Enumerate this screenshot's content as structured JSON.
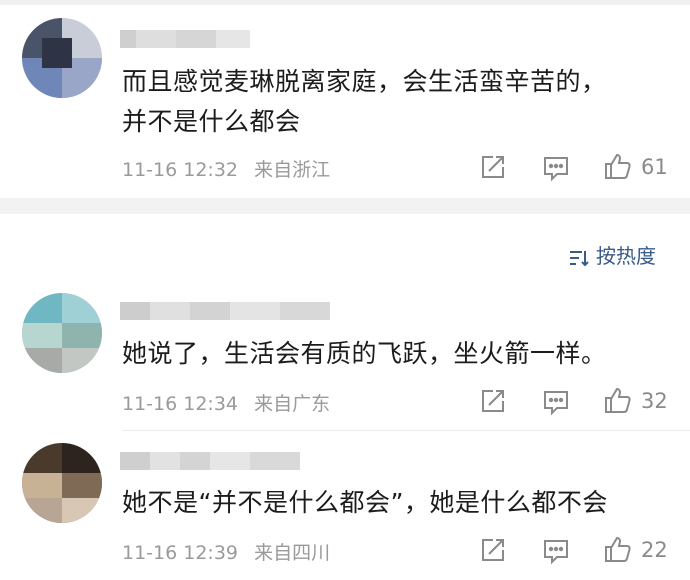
{
  "comments": [
    {
      "text_lines": [
        "而且感觉麦琳脱离家庭，会生活蛮辛苦的，",
        "并不是什么都会"
      ],
      "time": "11-16 12:32",
      "location": "来自浙江",
      "likes": "61"
    },
    {
      "text_lines": [
        "她说了，生活会有质的飞跃，坐火箭一样。"
      ],
      "time": "11-16 12:34",
      "location": "来自广东",
      "likes": "32"
    },
    {
      "text_lines": [
        "她不是“并不是什么都会”，她是什么都不会"
      ],
      "time": "11-16 12:39",
      "location": "来自四川",
      "likes": "22"
    }
  ],
  "sort": {
    "label": "按热度"
  },
  "icons": {
    "share": "share-icon",
    "comment": "comment-icon",
    "like": "like-icon",
    "sort": "sort-icon"
  },
  "colors": {
    "text": "#1c1c1c",
    "meta": "#9a9a9a",
    "sort": "#3a5a8a",
    "band": "#f2f2f2"
  }
}
